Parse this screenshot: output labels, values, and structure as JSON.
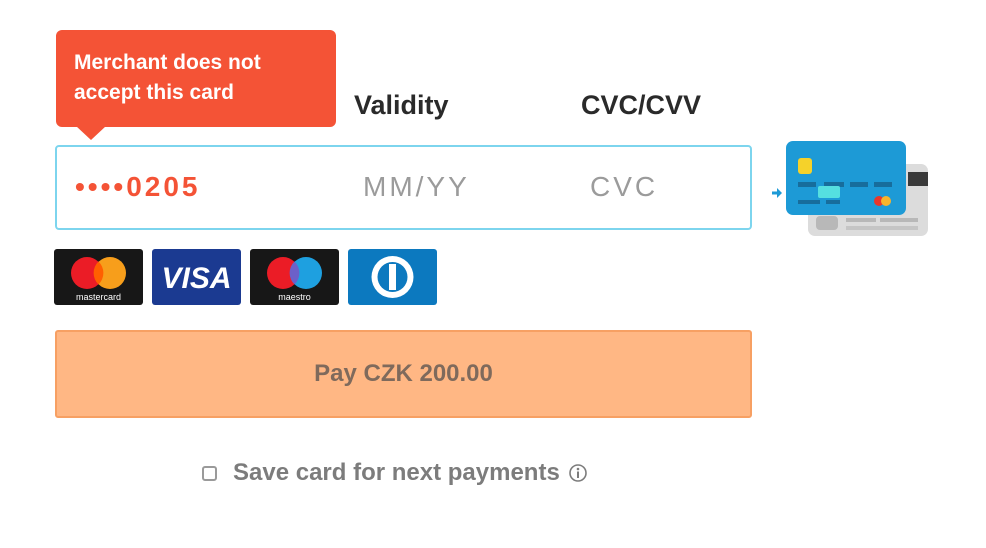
{
  "tooltip": {
    "message": "Merchant does not accept this card"
  },
  "labels": {
    "validity": "Validity",
    "cvc": "CVC/CVV"
  },
  "card_input": {
    "number_value": "••••0205",
    "expiry_placeholder": "MM/YY",
    "cvc_placeholder": "CVC"
  },
  "brands": [
    {
      "name": "mastercard",
      "caption": "mastercard"
    },
    {
      "name": "visa",
      "caption": "VISA"
    },
    {
      "name": "maestro",
      "caption": "maestro"
    },
    {
      "name": "diners-club",
      "caption": ""
    }
  ],
  "pay_button": {
    "label": "Pay CZK 200.00"
  },
  "save_card": {
    "label": "Save card for next payments",
    "checked": false
  },
  "colors": {
    "error": "#f45336",
    "input_border": "#7dd5ee",
    "pay_button_bg": "#ffb784",
    "pay_button_text": "#7f6a5c"
  }
}
